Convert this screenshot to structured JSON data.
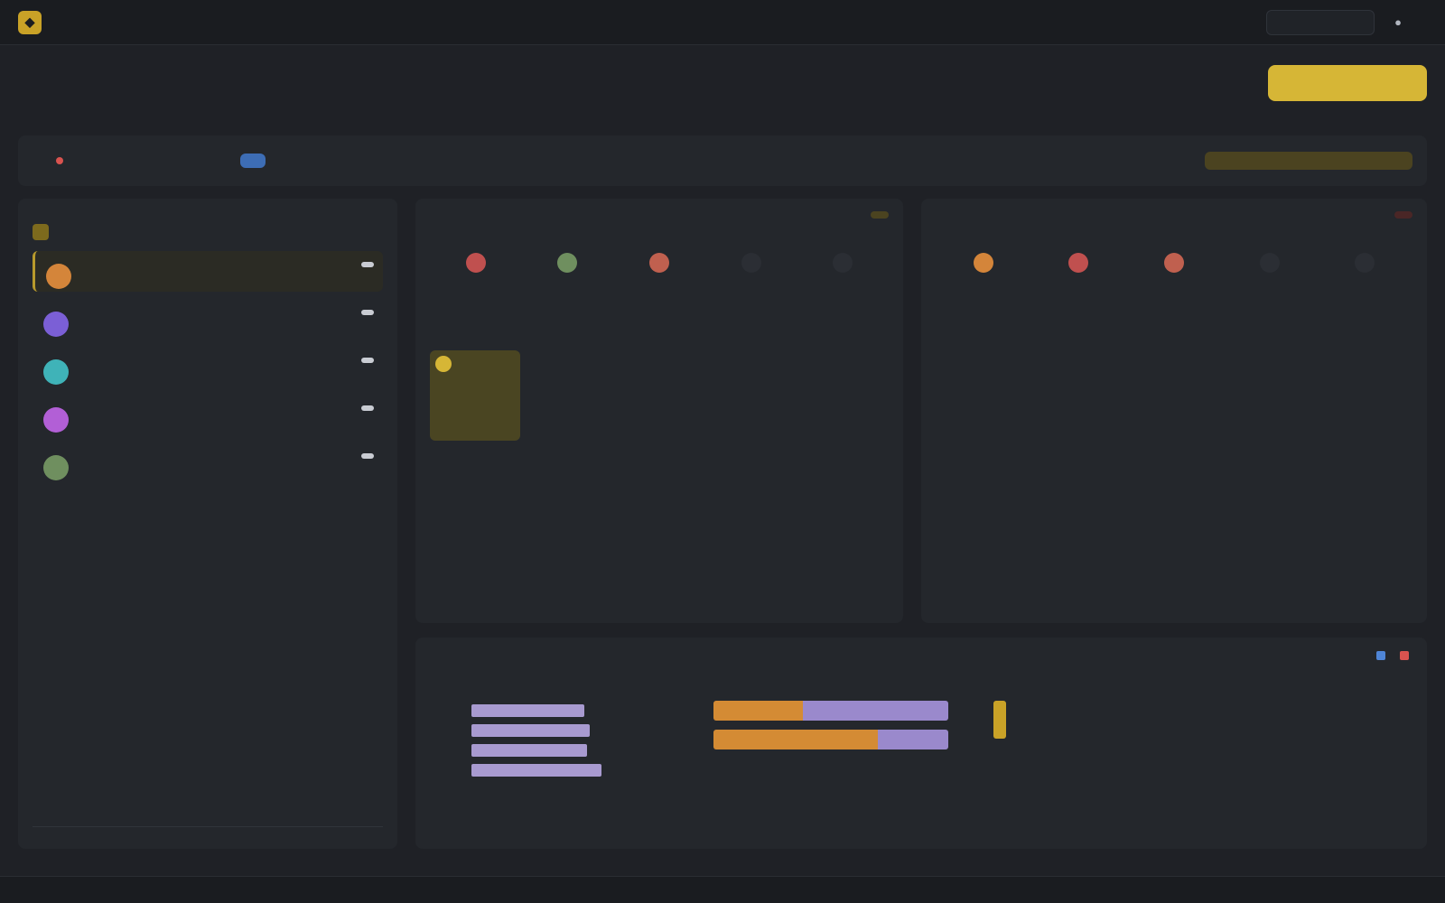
{
  "nav": {
    "brand": "",
    "links": [
      "",
      "",
      "",
      "",
      "",
      "",
      "",
      "",
      ""
    ],
    "search_placeholder": "",
    "account": "",
    "signout": ""
  },
  "header": {
    "title": "",
    "subtitle": "",
    "action1": "",
    "action2": "",
    "primary": ""
  },
  "filters": {
    "label": "",
    "chip1": "",
    "chip2": "",
    "chip3": "",
    "segments": [
      "",
      "",
      "",
      ""
    ],
    "export": ""
  },
  "list": {
    "title": "",
    "link": "",
    "filter_label": "",
    "filter_value": "",
    "items": [
      {
        "name": "",
        "meta": "",
        "text": "",
        "count": "",
        "color": "#d4853a"
      },
      {
        "name": "",
        "meta": "",
        "text": "",
        "count": "",
        "color": "#7b5fd6"
      },
      {
        "name": "",
        "meta": "",
        "text": "",
        "count": "",
        "color": "#3fb3b8"
      },
      {
        "name": "",
        "meta": "",
        "text": "",
        "count": "",
        "color": "#b25fd6"
      },
      {
        "name": "",
        "meta": "",
        "text": "",
        "count": "",
        "color": "#6f8f5f"
      }
    ],
    "more": "",
    "footer": ""
  },
  "card_left": {
    "title": "",
    "sub": "",
    "tag": "",
    "title_color": "#4f85d6"
  },
  "card_right": {
    "title": "",
    "sub": "",
    "tag": "",
    "title_color": "#d9534f"
  },
  "analytics": {
    "title": "",
    "legend1": "",
    "legend2": "",
    "bars_left": [
      {
        "label": "",
        "value": 0.78,
        "text": ""
      },
      {
        "label": "",
        "value": 0.82,
        "text": ""
      },
      {
        "label": "",
        "value": 0.8,
        "text": ""
      },
      {
        "label": "",
        "value": 0.9,
        "text": ""
      }
    ],
    "stack": [
      {
        "orange": 0.38,
        "purple": 0.62
      },
      {
        "orange": 0.7,
        "purple": 0.3
      }
    ],
    "stack_caption": "",
    "kpi_text": "",
    "note": ""
  },
  "status": {
    "left": "",
    "mid1": "",
    "mid2": "",
    "right": ""
  }
}
